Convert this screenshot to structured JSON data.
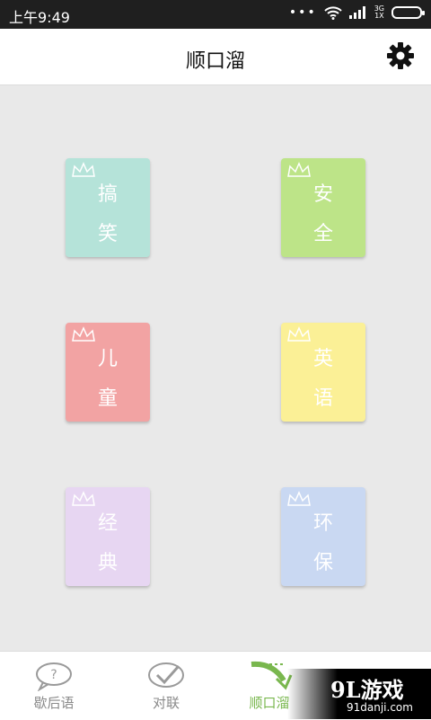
{
  "status_bar": {
    "time": "上午9:49",
    "dots": "•••",
    "network_top": "3G",
    "network_bottom": "1X"
  },
  "app_bar": {
    "title": "顺口溜"
  },
  "tiles": [
    {
      "line1": "搞",
      "line2": "笑",
      "color": "#b5e3d9"
    },
    {
      "line1": "安",
      "line2": "全",
      "color": "#bde488"
    },
    {
      "line1": "儿",
      "line2": "童",
      "color": "#f2a3a3"
    },
    {
      "line1": "英",
      "line2": "语",
      "color": "#fbf096"
    },
    {
      "line1": "经",
      "line2": "典",
      "color": "#e7d6f2"
    },
    {
      "line1": "环",
      "line2": "保",
      "color": "#c9d8f2"
    }
  ],
  "tabs": [
    {
      "label": "歇后语",
      "active": false
    },
    {
      "label": "对联",
      "active": false
    },
    {
      "label": "顺口溜",
      "active": true
    }
  ],
  "colors": {
    "active_tab": "#79b74e",
    "inactive_tab": "#8a8a8a"
  },
  "watermark": {
    "logo": "9L游戏",
    "url": "91danji.com"
  }
}
